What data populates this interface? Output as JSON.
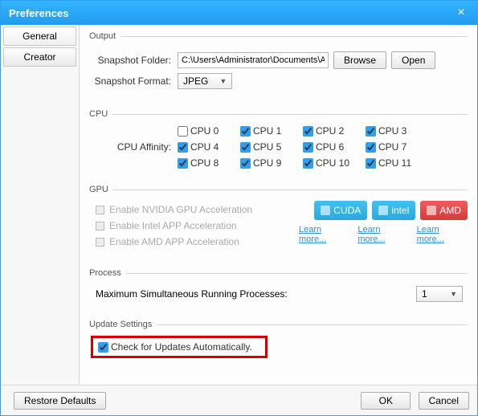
{
  "window": {
    "title": "Preferences"
  },
  "sidebar": {
    "tabs": [
      "General",
      "Creator"
    ]
  },
  "output": {
    "legend": "Output",
    "snapshot_folder_label": "Snapshot Folder:",
    "snapshot_folder_value": "C:\\Users\\Administrator\\Documents\\A",
    "browse": "Browse",
    "open": "Open",
    "snapshot_format_label": "Snapshot Format:",
    "snapshot_format_value": "JPEG"
  },
  "cpu": {
    "legend": "CPU",
    "affinity_label": "CPU Affinity:",
    "items": [
      "CPU 0",
      "CPU 1",
      "CPU 2",
      "CPU 3",
      "CPU 4",
      "CPU 5",
      "CPU 6",
      "CPU 7",
      "CPU 8",
      "CPU 9",
      "CPU 10",
      "CPU 11"
    ]
  },
  "gpu": {
    "legend": "GPU",
    "nvidia": "Enable NVIDIA GPU Acceleration",
    "intel": "Enable Intel APP Acceleration",
    "amd": "Enable AMD APP Acceleration",
    "btn_cuda": "CUDA",
    "btn_intel": "intel",
    "btn_amd": "AMD",
    "learn": "Learn more..."
  },
  "process": {
    "legend": "Process",
    "label": "Maximum Simultaneous Running Processes:",
    "value": "1"
  },
  "update": {
    "legend": "Update Settings",
    "label": "Check for Updates Automatically."
  },
  "footer": {
    "restore": "Restore Defaults",
    "ok": "OK",
    "cancel": "Cancel"
  }
}
